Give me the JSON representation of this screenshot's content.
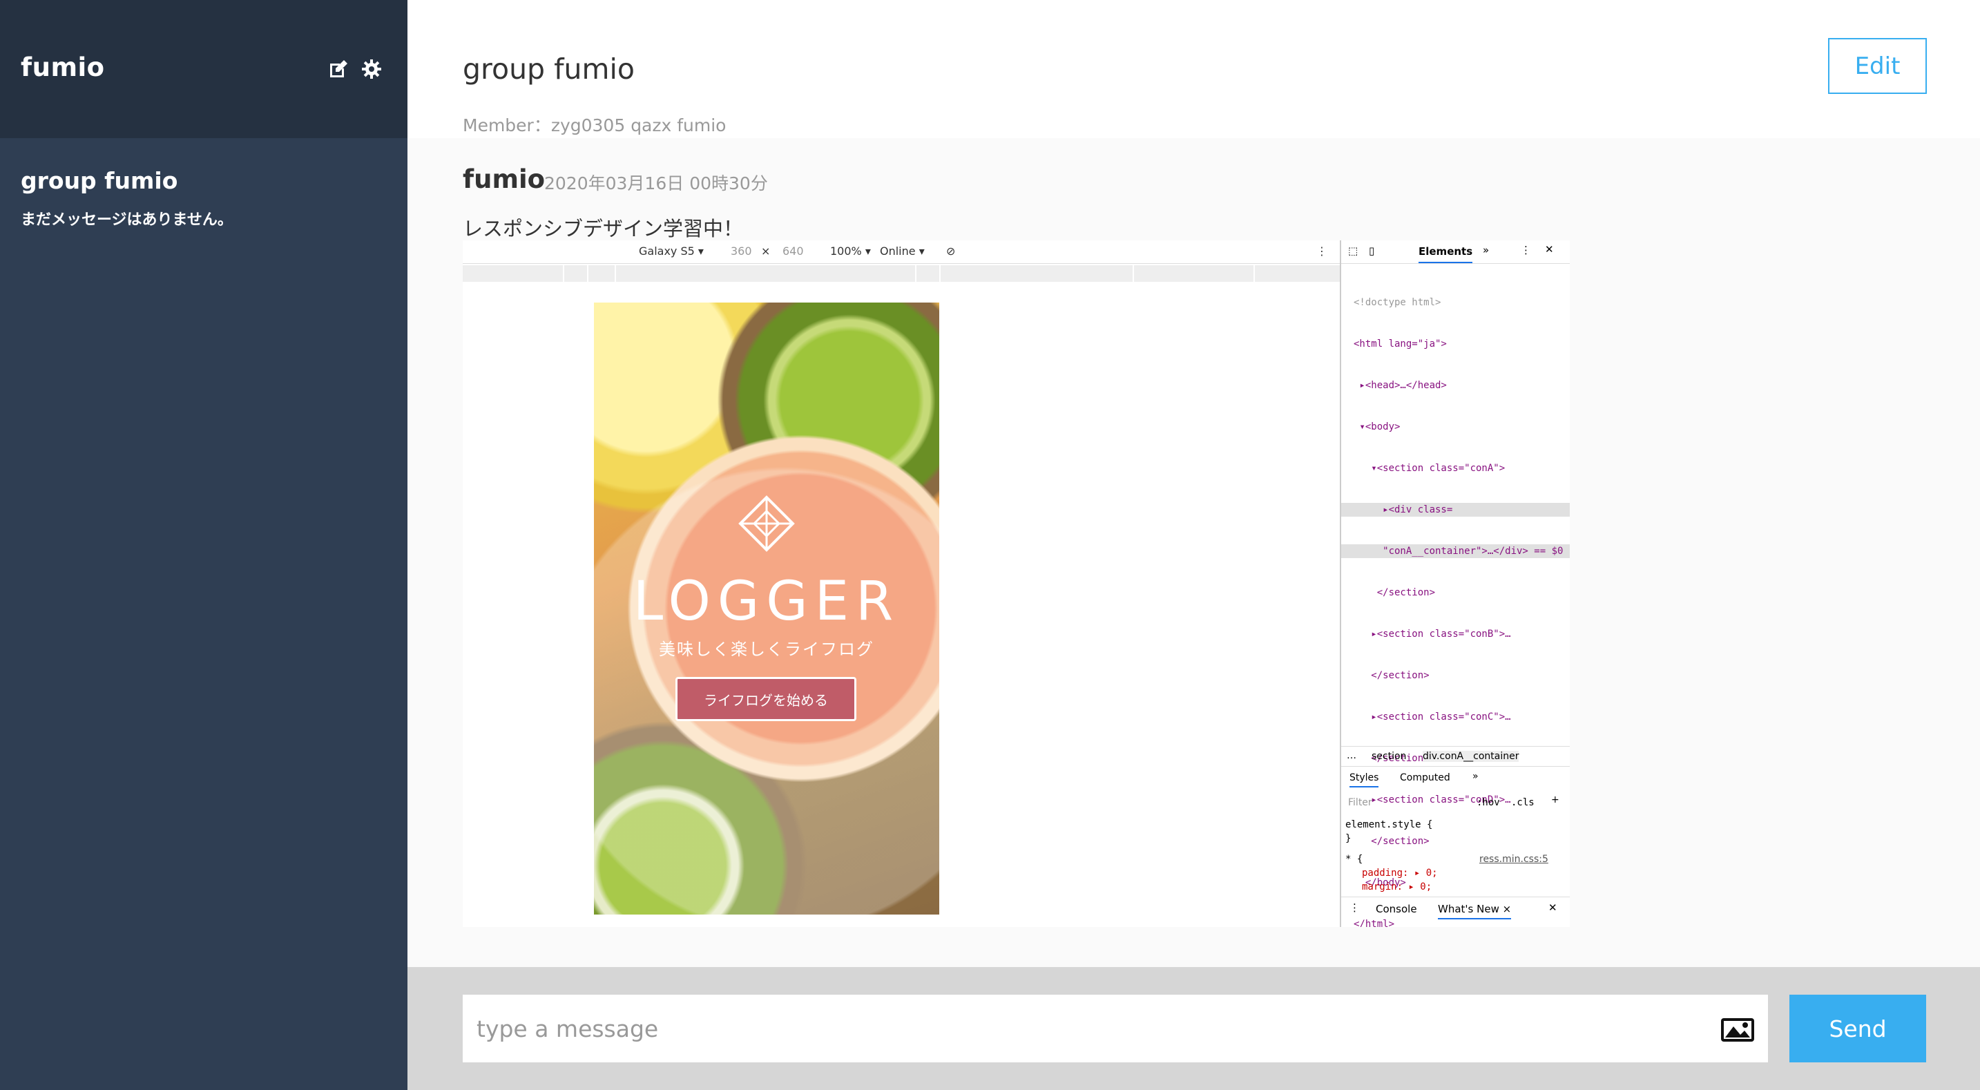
{
  "sidebar": {
    "user_name": "fumio",
    "edit_icon": "edit-icon",
    "settings_icon": "gear-icon",
    "groups": [
      {
        "name": "group fumio",
        "last_message": "まだメッセージはありません。"
      }
    ]
  },
  "header": {
    "group_title": "group fumio",
    "members": "Member：zyg0305 qazx fumio",
    "edit_label": "Edit"
  },
  "messages": [
    {
      "user": "fumio",
      "date": "2020年03月16日 00時30分",
      "text": "レスポンシブデザイン学習中！",
      "image": {
        "toolbar": {
          "device": "Galaxy S5 ▾",
          "width": "360",
          "times": "×",
          "height": "640",
          "zoom": "100% ▾",
          "network": "Online ▾"
        },
        "logo_text": "LOGGER",
        "logo_sub": "美味しく楽しくライフログ",
        "logo_button": "ライフログを始める",
        "devtools_tab": "Elements",
        "crumb_1": "section",
        "crumb_2": "div.conA__container",
        "styles_tab": "Styles",
        "computed_tab": "Computed",
        "filter": "Filter",
        "hov": ":hov",
        "cls": ".cls",
        "element_style": "element.style {",
        "close_brace": "}",
        "css_source": "ress.min.css:5",
        "padding": "padding: ▸ 0;",
        "margin": "margin: ▸ 0;",
        "console_tab": "Console",
        "whats_new_tab": "What's New ×",
        "code_lines": [
          "<!doctype html>",
          "<html lang=\"ja\">",
          " ▸<head>…</head>",
          " ▾<body>",
          "   ▾<section class=\"conA\">",
          "     ▸<div class=",
          "     \"conA__container\">…</div> == $0",
          "    </section>",
          "   ▸<section class=\"conB\">…",
          "   </section>",
          "   ▸<section class=\"conC\">…",
          "   </section>",
          "   ▸<section class=\"conD\">…",
          "   </section>",
          "  </body>",
          "</html>"
        ]
      }
    }
  ],
  "composer": {
    "placeholder": "type a message",
    "image_icon": "image-icon",
    "send_label": "Send"
  },
  "colors": {
    "sidebar_bg": "#2f3e53",
    "sidebar_head_bg": "#253141",
    "accent": "#38aef0",
    "composer_bg": "#d6d6d6"
  }
}
